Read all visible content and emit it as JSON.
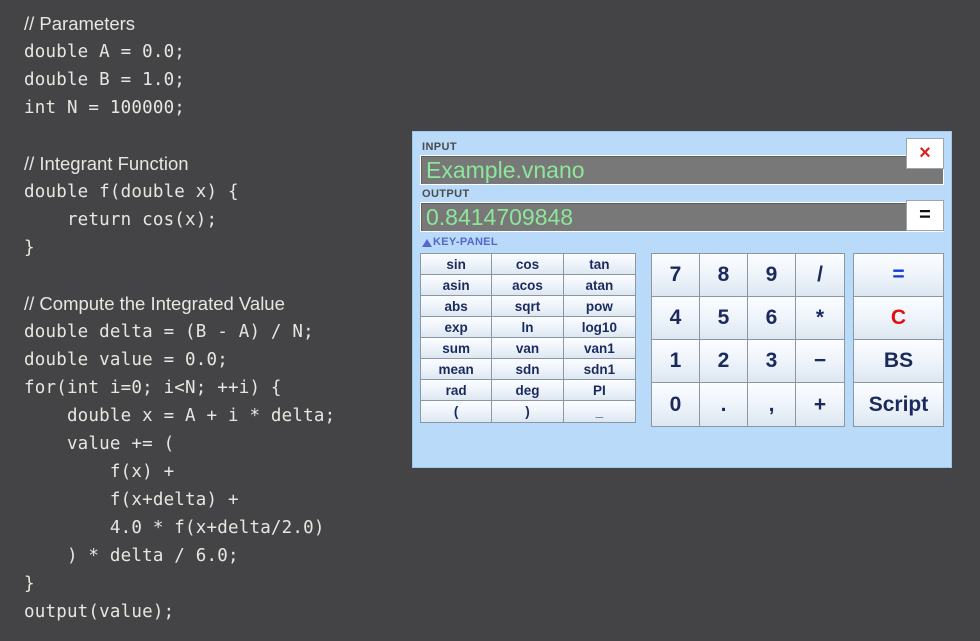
{
  "editor": {
    "lines": [
      {
        "text": "// Parameters",
        "type": "comment"
      },
      {
        "text": "double A = 0.0;",
        "type": "code"
      },
      {
        "text": "double B = 1.0;",
        "type": "code"
      },
      {
        "text": "int N = 100000;",
        "type": "code"
      },
      {
        "text": "",
        "type": "blank"
      },
      {
        "text": "// Integrant Function",
        "type": "comment"
      },
      {
        "text": "double f(double x) {",
        "type": "code"
      },
      {
        "text": "    return cos(x);",
        "type": "code"
      },
      {
        "text": "}",
        "type": "code"
      },
      {
        "text": "",
        "type": "blank"
      },
      {
        "text": "// Compute the Integrated Value",
        "type": "comment"
      },
      {
        "text": "double delta = (B - A) / N;",
        "type": "code"
      },
      {
        "text": "double value = 0.0;",
        "type": "code"
      },
      {
        "text": "for(int i=0; i<N; ++i) {",
        "type": "code"
      },
      {
        "text": "    double x = A + i * delta;",
        "type": "code"
      },
      {
        "text": "    value += (",
        "type": "code"
      },
      {
        "text": "        f(x) +",
        "type": "code"
      },
      {
        "text": "        f(x+delta) +",
        "type": "code"
      },
      {
        "text": "        4.0 * f(x+delta/2.0)",
        "type": "code"
      },
      {
        "text": "    ) * delta / 6.0;",
        "type": "code"
      },
      {
        "text": "}",
        "type": "code"
      },
      {
        "text": "output(value);",
        "type": "code"
      }
    ]
  },
  "calculator": {
    "input": {
      "label": "INPUT",
      "value": "Example.vnano"
    },
    "output": {
      "label": "OUTPUT",
      "value": "0.8414709848"
    },
    "close_button": "×",
    "equals_button": "=",
    "key_panel_label": "KEY-PANEL",
    "function_keys": [
      "sin",
      "cos",
      "tan",
      "asin",
      "acos",
      "atan",
      "abs",
      "sqrt",
      "pow",
      "exp",
      "ln",
      "log10",
      "sum",
      "van",
      "van1",
      "mean",
      "sdn",
      "sdn1",
      "rad",
      "deg",
      "PI",
      "(",
      ")",
      "_"
    ],
    "number_keys": [
      "7",
      "8",
      "9",
      "/",
      "4",
      "5",
      "6",
      "*",
      "1",
      "2",
      "3",
      "−",
      "0",
      ".",
      ",",
      "+"
    ],
    "action_keys": [
      {
        "label": "=",
        "style": "k-blue"
      },
      {
        "label": "C",
        "style": "k-red"
      },
      {
        "label": "BS",
        "style": "k-navy"
      },
      {
        "label": "Script",
        "style": "k-navy"
      }
    ]
  },
  "colors": {
    "background": "#444446",
    "panel": "#b9daf8",
    "field_bg": "#787878",
    "field_text": "#8ce79a",
    "key_text": "#1b2a5e",
    "accent_blue": "#1139d8",
    "accent_red": "#e01010",
    "key_panel_label": "#5566cc"
  }
}
